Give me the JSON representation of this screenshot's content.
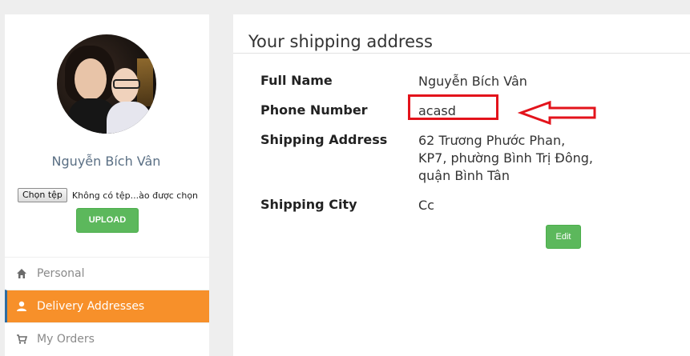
{
  "sidebar": {
    "username": "Nguyễn Bích Vân",
    "file_button_label": "Chọn tệp",
    "file_status": "Không có tệp...ào được chọn",
    "upload_label": "UPLOAD",
    "menu": [
      {
        "label": "Personal",
        "icon": "home-icon",
        "active": false
      },
      {
        "label": "Delivery Addresses",
        "icon": "user-icon",
        "active": true
      },
      {
        "label": "My Orders",
        "icon": "cart-icon",
        "active": false
      }
    ]
  },
  "main": {
    "title": "Your shipping address",
    "rows": [
      {
        "label": "Full Name",
        "value": "Nguyễn Bích Vân"
      },
      {
        "label": "Phone Number",
        "value": "acasd"
      },
      {
        "label": "Shipping Address",
        "value": "62 Trương Phước Phan, KP7, phường Bình Trị Đông, quận Bình Tân"
      },
      {
        "label": "Shipping City",
        "value": "Cc"
      }
    ],
    "edit_label": "Edit"
  },
  "colors": {
    "accent_orange": "#f7902a",
    "button_green": "#5cb85c",
    "annotation_red": "#e3131b"
  }
}
